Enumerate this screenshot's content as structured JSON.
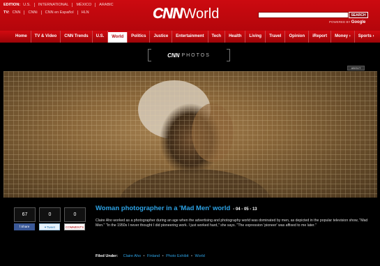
{
  "header": {
    "edition_label": "EDITION:",
    "editions": [
      "U.S.",
      "INTERNATIONAL",
      "MÉXICO",
      "ARABIC"
    ],
    "tv_label": "TV:",
    "tv_channels": [
      "CNN",
      "CNNi",
      "CNN en Español",
      "HLN"
    ],
    "logo_cnn": "CNN",
    "logo_world": "World",
    "search_button": "SEARCH",
    "powered_by": "POWERED BY",
    "google": "Google"
  },
  "nav": {
    "items": [
      "Home",
      "TV & Video",
      "CNN Trends",
      "U.S.",
      "World",
      "Politics",
      "Justice",
      "Entertainment",
      "Tech",
      "Health",
      "Living",
      "Travel",
      "Opinion",
      "iReport",
      "Money ›",
      "Sports ›"
    ],
    "active": "World"
  },
  "photos_header": {
    "cnn": "CNN",
    "label": "PHOTOS"
  },
  "about_button": "ABOUT",
  "stats": {
    "shares": "67",
    "tweets": "0",
    "comments": "0",
    "share_label": "Share",
    "tweet_label": "Tweet",
    "comments_label": "COMMENTS"
  },
  "article": {
    "title": "Woman photographer in a 'Mad Men' world",
    "date": "- 04 - 05 - 13",
    "description": "Claire Aho worked as a photographer during an age when the advertising and photography world was dominated by men, as depicted in the popular television show, \"Mad Men.\" \"In the 1950s I never thought I did pioneering work. I just worked hard,\" she says. \"The expression 'pioneer' was affixed to me later.\"",
    "filed_label": "Filed Under:",
    "tags": [
      "Claire Aho",
      "Finland",
      "Photo Exhibit",
      "World"
    ]
  },
  "colors": {
    "brand_red": "#c4080e",
    "link_blue": "#2da3e6",
    "background": "#000000"
  }
}
